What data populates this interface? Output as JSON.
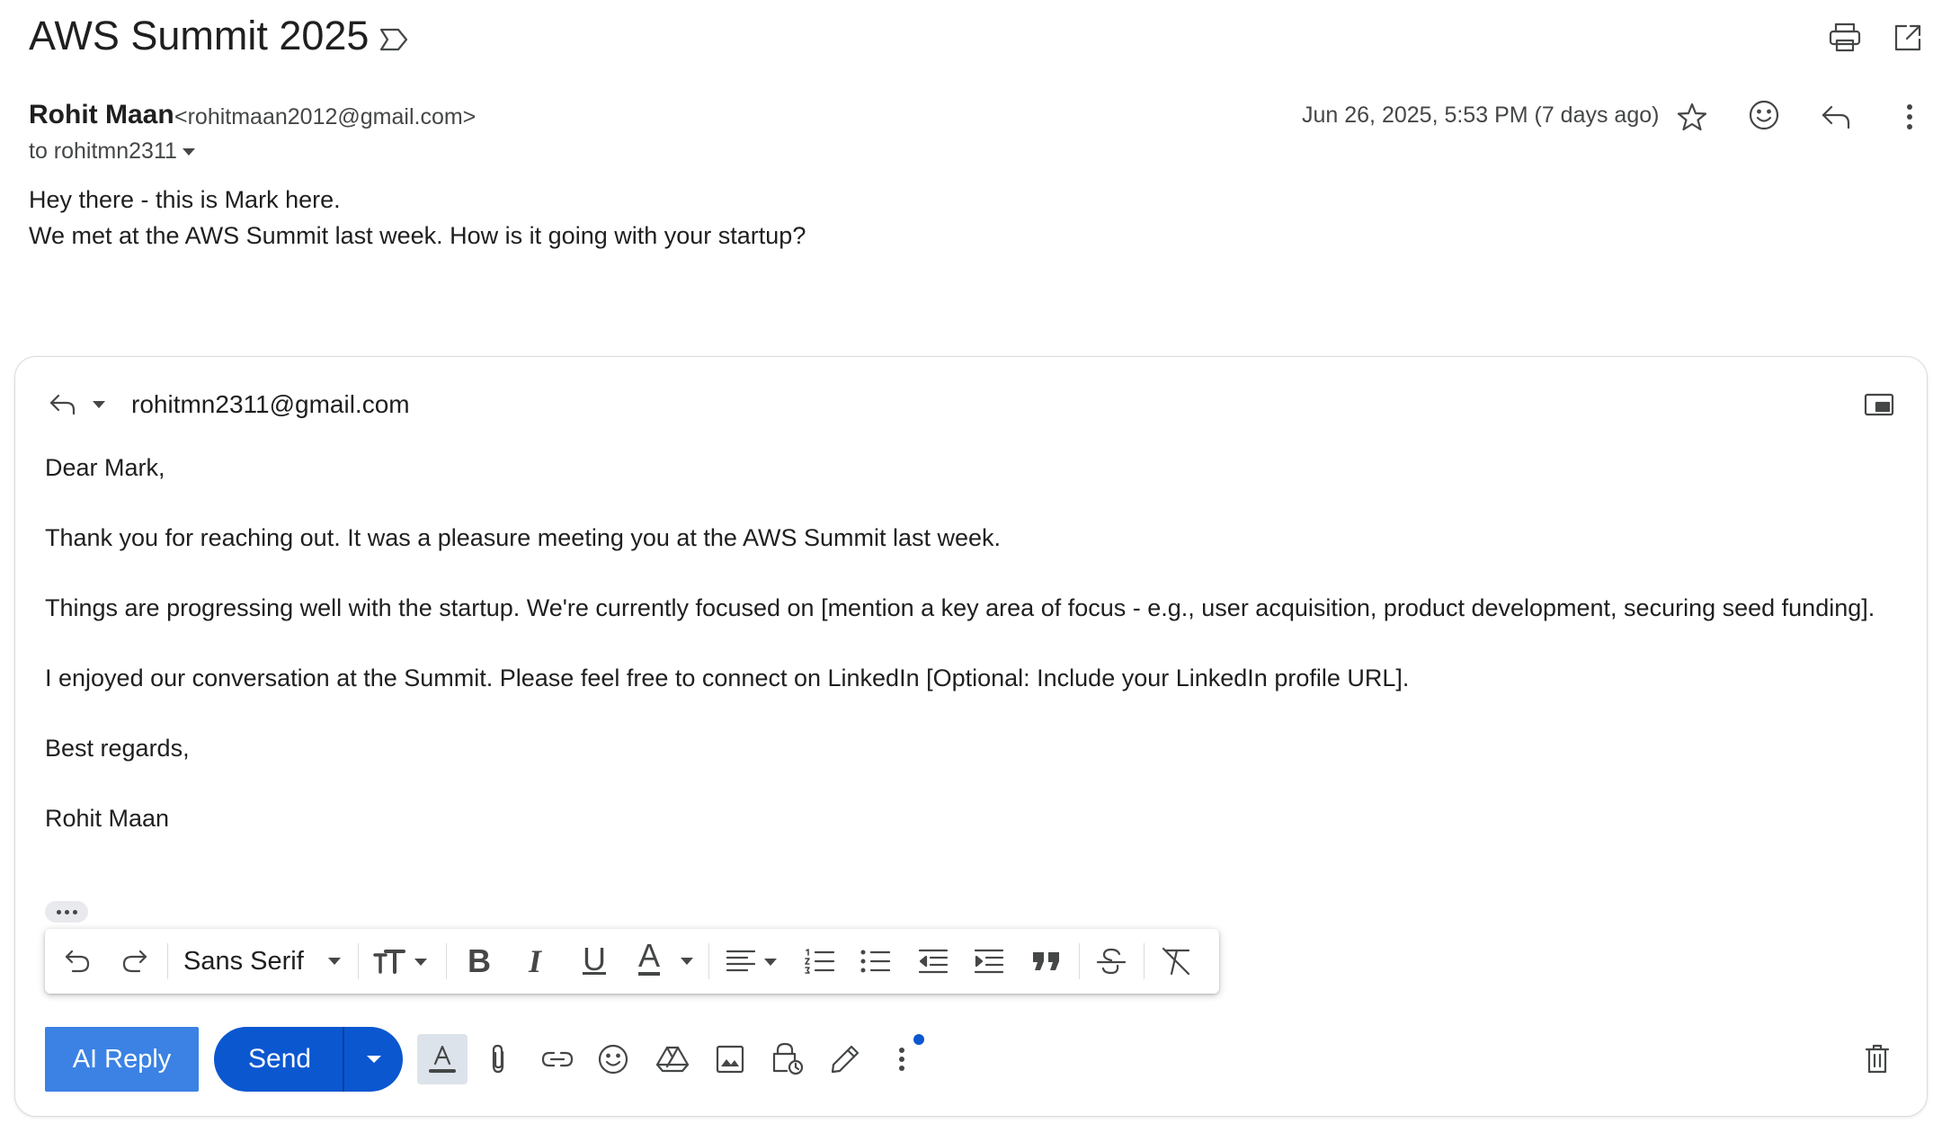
{
  "email": {
    "subject": "AWS Summit 2025",
    "sender_name": "Rohit Maan",
    "sender_email": "<rohitmaan2012@gmail.com>",
    "to_line": "to rohitmn2311",
    "date": "Jun 26, 2025, 5:53 PM (7 days ago)",
    "body_lines": [
      "Hey there - this is Mark here.",
      "We met at the AWS Summit last week. How is it going with your startup?"
    ]
  },
  "reply": {
    "recipient": "rohitmn2311@gmail.com",
    "lines": [
      "Dear Mark,",
      "Thank you for reaching out. It was a pleasure meeting you at the AWS Summit last week.",
      "Things are progressing well with the startup. We're currently focused on [mention a key area of focus - e.g., user acquisition, product development, securing seed funding].",
      "I enjoyed our conversation at the Summit. Please feel free to connect on LinkedIn [Optional: Include your LinkedIn profile URL].",
      "Best regards,",
      "Rohit Maan"
    ]
  },
  "toolbar": {
    "font": "Sans Serif",
    "bold": "B",
    "italic": "I",
    "underline": "U",
    "text_color": "A"
  },
  "actions": {
    "ai_reply": "AI Reply",
    "send": "Send"
  },
  "icons": [
    "label-icon",
    "print-icon",
    "open-in-new-icon",
    "star-icon",
    "emoji-icon",
    "reply-icon",
    "more-vert-icon",
    "pop-out-icon",
    "undo-icon",
    "redo-icon",
    "text-size-icon",
    "align-icon",
    "numbered-list-icon",
    "bulleted-list-icon",
    "indent-less-icon",
    "indent-more-icon",
    "quote-icon",
    "strikethrough-icon",
    "clear-format-icon",
    "attach-icon",
    "link-icon",
    "drive-icon",
    "photo-icon",
    "confidential-icon",
    "signature-icon",
    "trash-icon"
  ],
  "colors": {
    "primary": "#0b57d0",
    "ai_reply": "#3b82e4",
    "text": "#1f1f1f",
    "secondary_text": "#444746"
  }
}
